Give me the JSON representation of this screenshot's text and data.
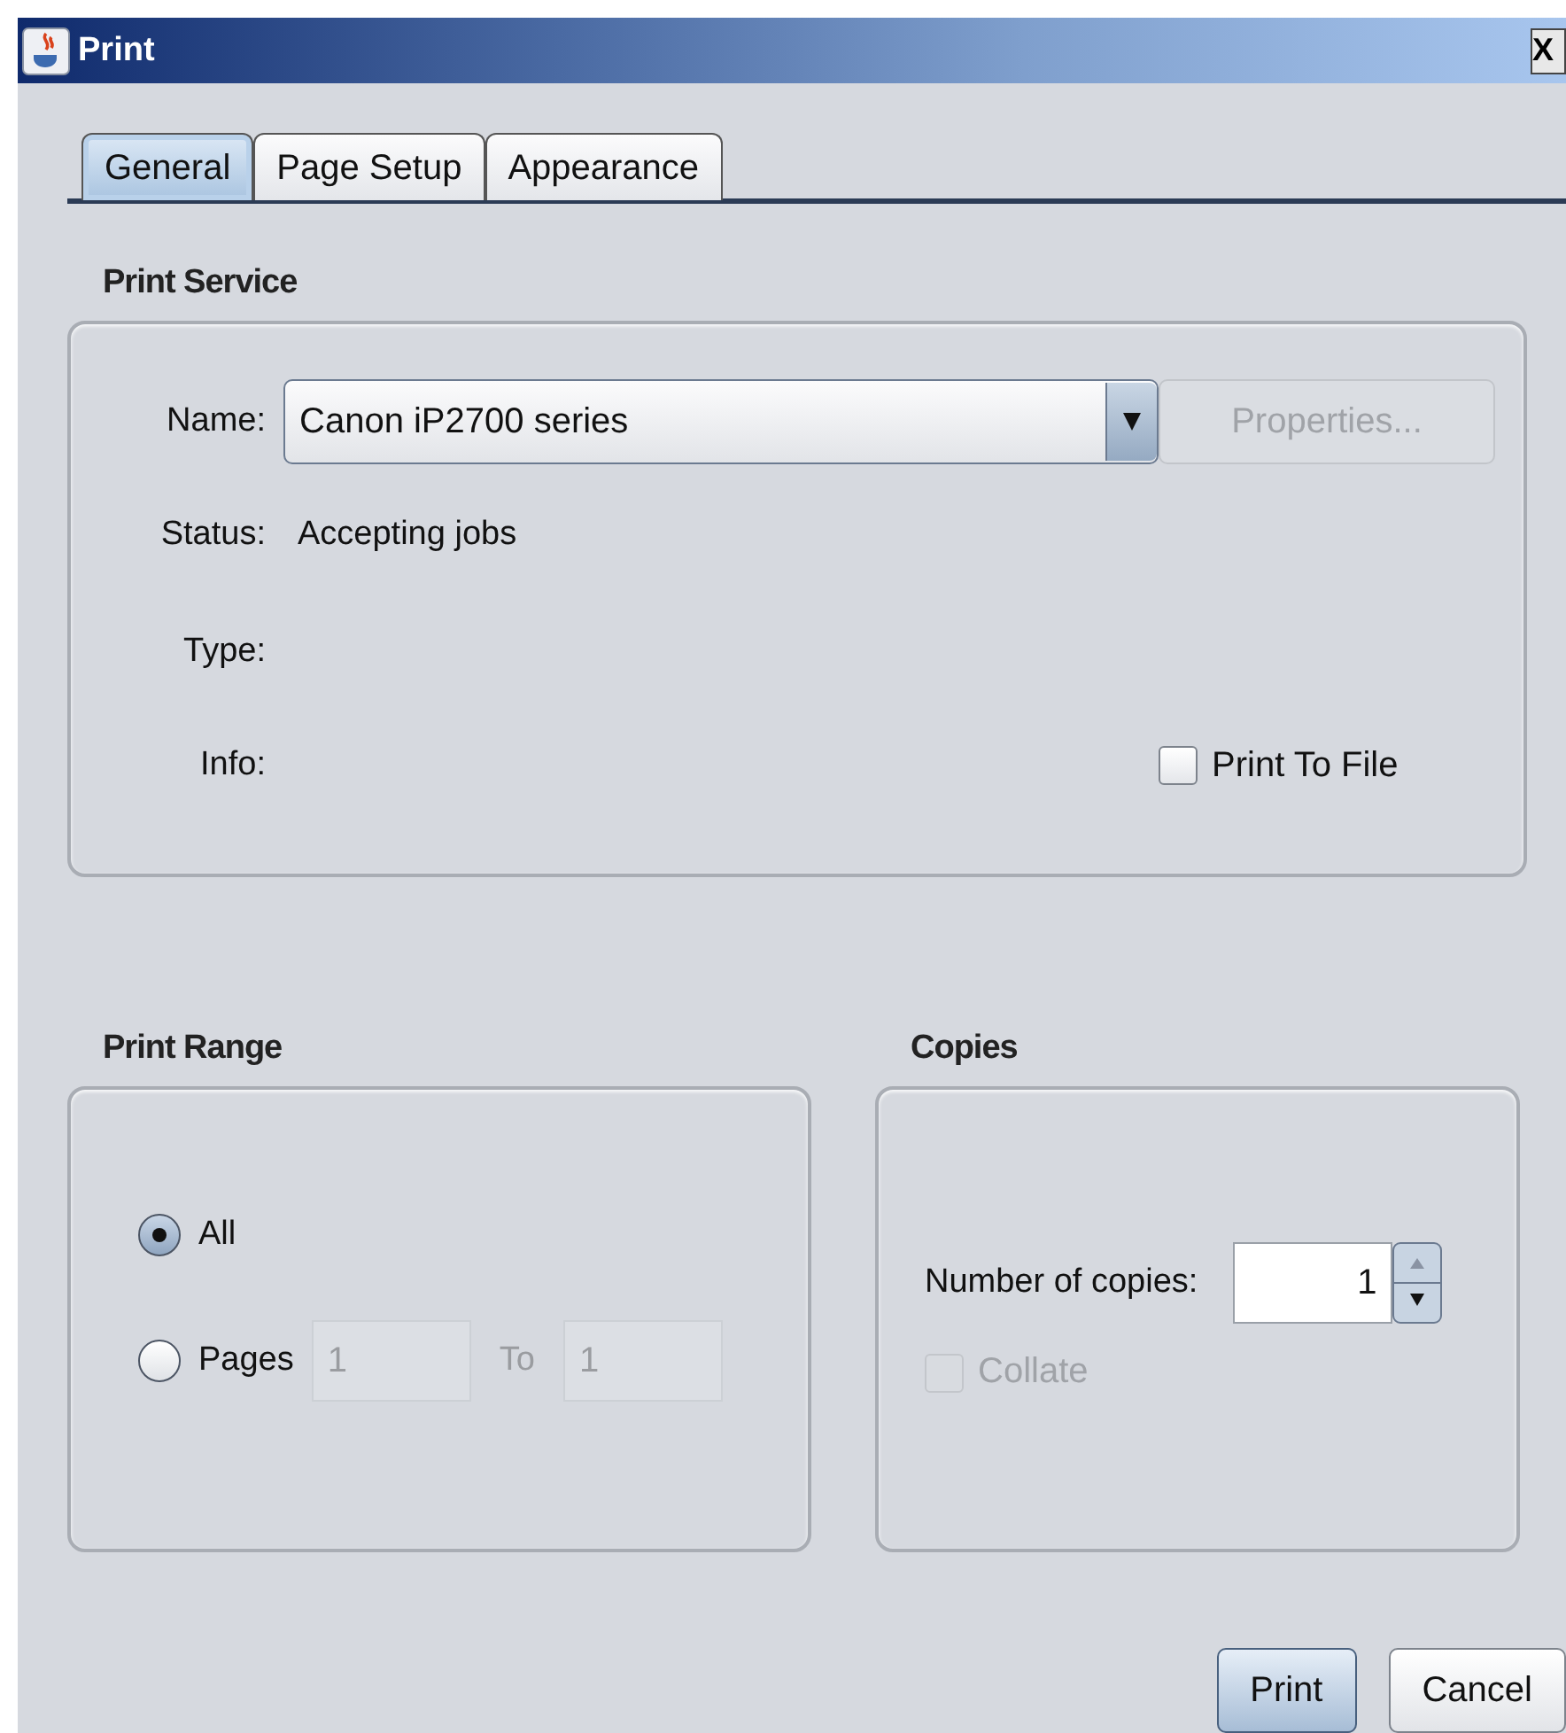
{
  "window": {
    "title": "Print",
    "close": "X"
  },
  "tabs": [
    {
      "label": "General",
      "selected": true
    },
    {
      "label": "Page Setup",
      "selected": false
    },
    {
      "label": "Appearance",
      "selected": false
    }
  ],
  "print_service": {
    "title": "Print Service",
    "name_label": "Name:",
    "printer": "Canon iP2700 series",
    "properties_button": {
      "label": "Properties...",
      "disabled": true
    },
    "status_label": "Status:",
    "status": "Accepting jobs",
    "type_label": "Type:",
    "info_label": "Info:",
    "print_to_file": {
      "label": "Print To File",
      "checked": false
    }
  },
  "print_range": {
    "title": "Print Range",
    "options": [
      {
        "label": "All",
        "selected": true
      },
      {
        "label": "Pages",
        "selected": false
      }
    ],
    "from": "1",
    "to_label": "To",
    "to": "1"
  },
  "copies": {
    "title": "Copies",
    "label": "Number of copies:",
    "value": "1",
    "collate": {
      "label": "Collate",
      "checked": false,
      "disabled": true
    }
  },
  "buttons": [
    {
      "label": "Print",
      "default": true
    },
    {
      "label": "Cancel",
      "default": false
    }
  ]
}
